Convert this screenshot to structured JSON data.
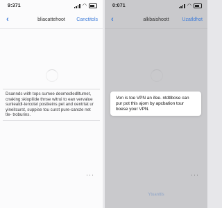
{
  "left_screen": {
    "status": {
      "time": "9:371"
    },
    "nav": {
      "back_symbol": "‹",
      "title": "bliacattehoot",
      "action_label": "Canctitols"
    },
    "body_text": "Dsannds with tops sumee deomedledlltumet, cnaking skiopilide thnse witrui to ean vervalue sunlealdl-tercotel postkeins pet and oentrtat ur yineitcurst, suppise tou curst pure-cancte net tle- troburins.",
    "more_symbol": "···"
  },
  "right_screen": {
    "status": {
      "time": "0:071"
    },
    "nav": {
      "back_symbol": "‹",
      "title": "alkbaishoott",
      "action_label": "Uzatldhot"
    },
    "dialog_text": "Von is toe VPN an ifee. ntdtlbose can pur pot thls ajom by apcbation tour boese your VPN.",
    "footer_label": "Ytuanttis",
    "more_symbol": "···"
  },
  "colors": {
    "accent": "#3b7ad9",
    "left_bg": "#fbfbfc",
    "right_overlay_bg": "#c9c9cc",
    "dialog_bg": "#ffffff"
  }
}
